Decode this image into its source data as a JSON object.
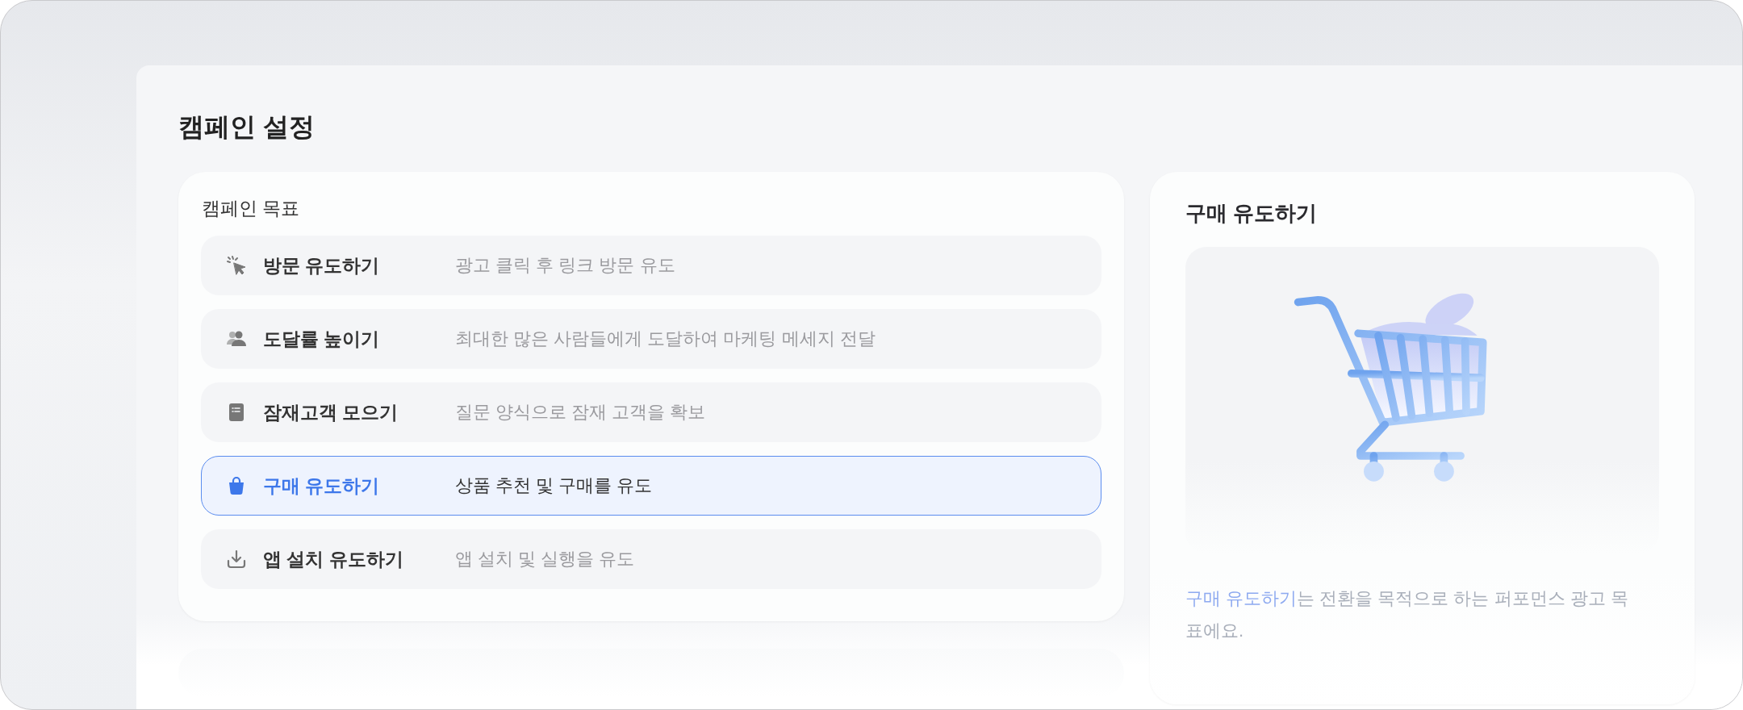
{
  "page_title": "캠페인 설정",
  "objective_card": {
    "title": "캠페인 목표",
    "options": [
      {
        "label": "방문 유도하기",
        "description": "광고 클릭 후 링크 방문 유도",
        "selected": false
      },
      {
        "label": "도달률 높이기",
        "description": "최대한 많은 사람들에게 도달하여 마케팅 메세지 전달",
        "selected": false
      },
      {
        "label": "잠재고객 모으기",
        "description": "질문 양식으로 잠재 고객을 확보",
        "selected": false
      },
      {
        "label": "구매 유도하기",
        "description": "상품 추천 및 구매를 유도",
        "selected": true
      },
      {
        "label": "앱 설치 유도하기",
        "description": "앱 설치 및 실행을 유도",
        "selected": false
      }
    ]
  },
  "detail_card": {
    "title": "구매 유도하기",
    "description_highlight": "구매 유도하기",
    "description_rest": "는 전환을 목적으로 하는 퍼포먼스 광고 목표에요."
  }
}
